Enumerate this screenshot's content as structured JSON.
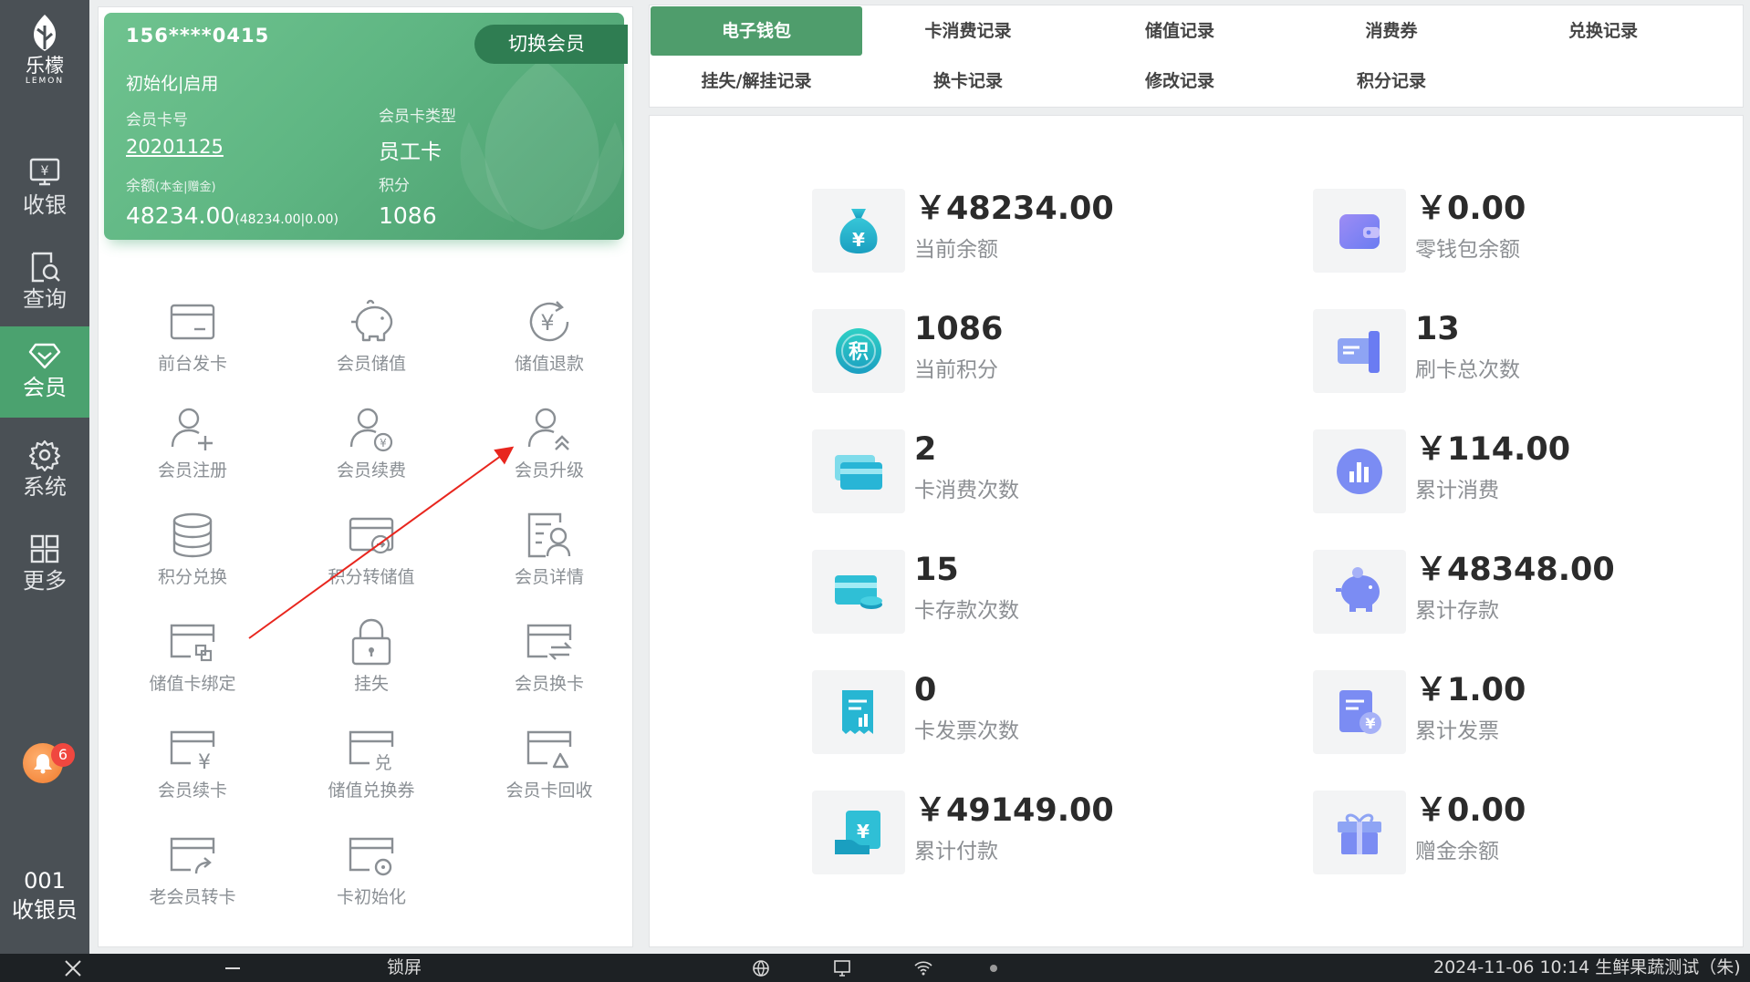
{
  "nav": {
    "logo_cn": "乐檬",
    "logo_en": "LEMON",
    "items": [
      {
        "label": "收银",
        "icon": "cashier-register-icon"
      },
      {
        "label": "查询",
        "icon": "search-document-icon"
      },
      {
        "label": "会员",
        "icon": "diamond-icon"
      },
      {
        "label": "系统",
        "icon": "gear-icon"
      },
      {
        "label": "更多",
        "icon": "grid-icon"
      }
    ],
    "active": "会员",
    "notification_count": "6",
    "cashier_id": "001",
    "cashier_label": "收银员"
  },
  "member_card": {
    "phone": "156****0415",
    "switch_label": "切换会员",
    "status": "初始化|启用",
    "card_no_label": "会员卡号",
    "card_no": "20201125",
    "card_type_label": "会员卡类型",
    "card_type": "员工卡",
    "balance_label": "余额",
    "balance_sub_label": "(本金|赠金)",
    "balance": "48234.00",
    "balance_detail": "(48234.00|0.00)",
    "points_label": "积分",
    "points": "1086"
  },
  "functions": [
    {
      "label": "前台发卡",
      "icon": "card-issue-icon"
    },
    {
      "label": "会员储值",
      "icon": "piggy-bank-icon"
    },
    {
      "label": "储值退款",
      "icon": "yuan-refund-icon"
    },
    {
      "label": "会员注册",
      "icon": "user-add-icon"
    },
    {
      "label": "会员续费",
      "icon": "user-yuan-icon"
    },
    {
      "label": "会员升级",
      "icon": "user-upgrade-icon"
    },
    {
      "label": "积分兑换",
      "icon": "coin-stack-icon"
    },
    {
      "label": "积分转储值",
      "icon": "card-transfer-icon"
    },
    {
      "label": "会员详情",
      "icon": "user-detail-icon"
    },
    {
      "label": "储值卡绑定",
      "icon": "card-bind-icon"
    },
    {
      "label": "挂失",
      "icon": "lock-icon"
    },
    {
      "label": "会员换卡",
      "icon": "card-swap-icon"
    },
    {
      "label": "会员续卡",
      "icon": "card-renew-icon"
    },
    {
      "label": "储值兑换券",
      "icon": "card-coupon-icon"
    },
    {
      "label": "会员卡回收",
      "icon": "card-recycle-icon"
    },
    {
      "label": "老会员转卡",
      "icon": "card-share-icon"
    },
    {
      "label": "卡初始化",
      "icon": "card-reset-icon"
    }
  ],
  "tabs": [
    {
      "label": "电子钱包",
      "active": true
    },
    {
      "label": "卡消费记录",
      "active": false
    },
    {
      "label": "储值记录",
      "active": false
    },
    {
      "label": "消费券",
      "active": false
    },
    {
      "label": "兑换记录",
      "active": false
    },
    {
      "label": "挂失/解挂记录",
      "active": false
    },
    {
      "label": "换卡记录",
      "active": false
    },
    {
      "label": "修改记录",
      "active": false
    },
    {
      "label": "积分记录",
      "active": false
    }
  ],
  "stats": [
    {
      "value": "￥48234.00",
      "caption": "当前余额",
      "icon": "money-bag-icon"
    },
    {
      "value": "￥0.00",
      "caption": "零钱包余额",
      "icon": "wallet-icon"
    },
    {
      "value": "1086",
      "caption": "当前积分",
      "icon": "points-icon"
    },
    {
      "value": "13",
      "caption": "刷卡总次数",
      "icon": "card-swipe-icon"
    },
    {
      "value": "2",
      "caption": "卡消费次数",
      "icon": "cards-icon"
    },
    {
      "value": "￥114.00",
      "caption": "累计消费",
      "icon": "bar-chart-icon"
    },
    {
      "value": "15",
      "caption": "卡存款次数",
      "icon": "card-coins-icon"
    },
    {
      "value": "￥48348.00",
      "caption": "累计存款",
      "icon": "piggy-bank-icon"
    },
    {
      "value": "0",
      "caption": "卡发票次数",
      "icon": "receipt-icon"
    },
    {
      "value": "￥1.00",
      "caption": "累计发票",
      "icon": "invoice-yuan-icon"
    },
    {
      "value": "￥49149.00",
      "caption": "累计付款",
      "icon": "payment-icon"
    },
    {
      "value": "￥0.00",
      "caption": "赠金余额",
      "icon": "gift-icon"
    }
  ],
  "taskbar": {
    "lock_label": "锁屏",
    "datetime": "2024-11-06 10:14",
    "store": "生鲜果蔬测试（朱)"
  },
  "colors": {
    "brand_green": "#4ba26f",
    "nav_bg": "#4a5055",
    "annotation_red": "#e8261e"
  }
}
